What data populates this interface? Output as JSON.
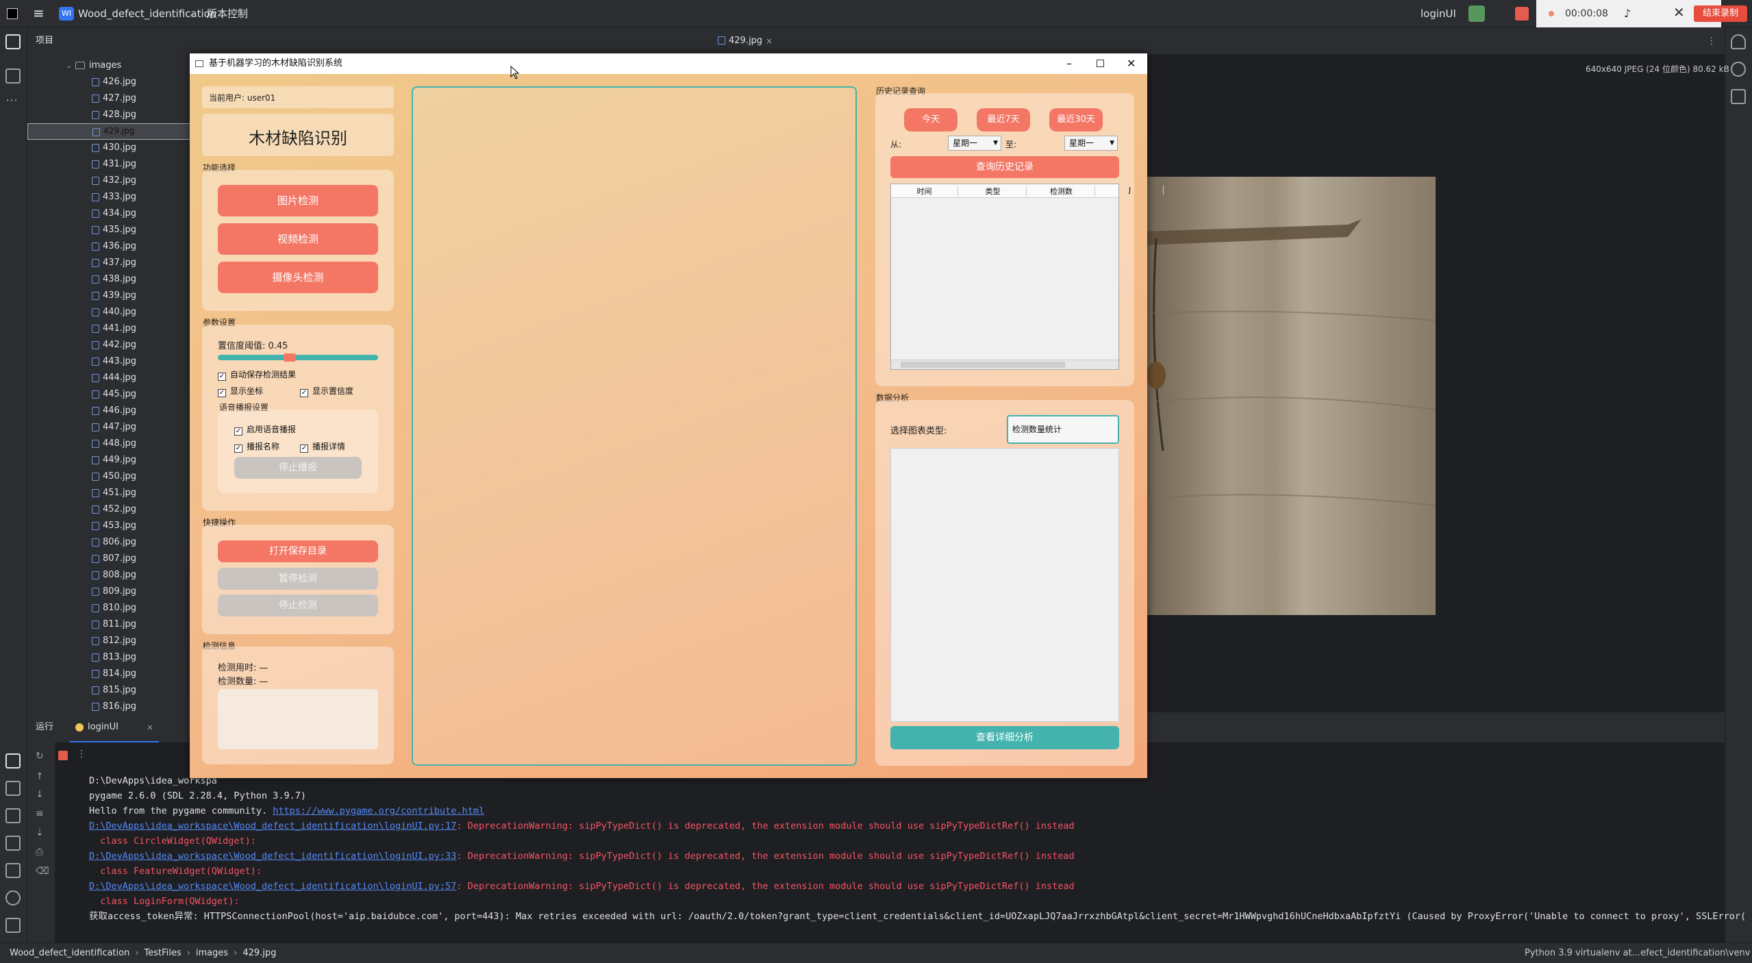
{
  "ide": {
    "project": "Wood_defect_identification",
    "project_badge": "WI",
    "vcs": "版本控制",
    "run_config": "loginUI",
    "project_label": "项目",
    "folder": "images",
    "editor_tab": "429.jpg",
    "image_info": "640x640 JPEG (24 位颜色) 80.62 kB",
    "run_label": "运行",
    "run_tab": "loginUI",
    "files": [
      "426.jpg",
      "427.jpg",
      "428.jpg",
      "429.jpg",
      "430.jpg",
      "431.jpg",
      "432.jpg",
      "433.jpg",
      "434.jpg",
      "435.jpg",
      "436.jpg",
      "437.jpg",
      "438.jpg",
      "439.jpg",
      "440.jpg",
      "441.jpg",
      "442.jpg",
      "443.jpg",
      "444.jpg",
      "445.jpg",
      "446.jpg",
      "447.jpg",
      "448.jpg",
      "449.jpg",
      "450.jpg",
      "451.jpg",
      "452.jpg",
      "453.jpg",
      "806.jpg",
      "807.jpg",
      "808.jpg",
      "809.jpg",
      "810.jpg",
      "811.jpg",
      "812.jpg",
      "813.jpg",
      "814.jpg",
      "815.jpg",
      "816.jpg"
    ],
    "selected_file": "429.jpg",
    "console": [
      "D:\\DevApps\\idea_workspa",
      "pygame 2.6.0 (SDL 2.28.4, Python 3.9.7)",
      "Hello from the pygame community. ",
      "https://www.pygame.org/contribute.html",
      "D:\\DevApps\\idea_workspace\\Wood_defect_identification\\loginUI.py:17",
      ": DeprecationWarning: sipPyTypeDict() is deprecated, the extension module should use sipPyTypeDictRef() instead",
      "  class CircleWidget(QWidget):",
      "D:\\DevApps\\idea_workspace\\Wood_defect_identification\\loginUI.py:33",
      ": DeprecationWarning: sipPyTypeDict() is deprecated, the extension module should use sipPyTypeDictRef() instead",
      "  class FeatureWidget(QWidget):",
      "D:\\DevApps\\idea_workspace\\Wood_defect_identification\\loginUI.py:57",
      ": DeprecationWarning: sipPyTypeDict() is deprecated, the extension module should use sipPyTypeDictRef() instead",
      "  class LoginForm(QWidget):",
      "获取access_token异常: HTTPSConnectionPool(host='aip.baidubce.com', port=443): Max retries exceeded with url: /oauth/2.0/token?grant_type=client_credentials&client_id=UOZxapLJQ7aaJrrxzhbGAtpl&client_secret=Mr1HWWpvghd16hUCneHdbxaAbIpfztYi (Caused by ProxyError('Unable to connect to proxy', SSLError(SSLEOF"
    ],
    "breadcrumb": [
      "Wood_defect_identification",
      "TestFiles",
      "images",
      "429.jpg"
    ],
    "interpreter": "Python 3.9 virtualenv at...efect_identification\\venv",
    "rec_time": "00:00:08",
    "rec_end": "结束录制"
  },
  "app": {
    "title": "基于机器学习的木材缺陷识别系统",
    "user": "当前用户: user01",
    "heading": "木材缺陷识别",
    "func_title": "功能选择",
    "btn_image": "图片检测",
    "btn_video": "视频检测",
    "btn_camera": "摄像头检测",
    "param_title": "参数设置",
    "conf_label": "置信度阈值: 0.45",
    "conf_value": 0.45,
    "cb_autosave": "自动保存检测结果",
    "cb_coords": "显示坐标",
    "cb_conf": "显示置信度",
    "voice_title": "语音播报设置",
    "cb_voice": "启用语音播报",
    "cb_name": "播报名称",
    "cb_detail": "播报详情",
    "btn_stop_voice": "停止播报",
    "quick_title": "快捷操作",
    "btn_open_dir": "打开保存目录",
    "btn_pause": "暂停检测",
    "btn_stop": "停止检测",
    "info_title": "检测信息",
    "time_label": "检测用时: —",
    "count_label": "检测数量: —",
    "history_title": "历史记录查询",
    "btn_today": "今天",
    "btn_7days": "最近7天",
    "btn_30days": "最近30天",
    "from_label": "从:",
    "to_label": "至:",
    "from_value": "星期一",
    "to_value": "星期一",
    "btn_query": "查询历史记录",
    "table_headers": [
      "时间",
      "类型",
      "检测数",
      "J"
    ],
    "analysis_title": "数据分析",
    "chart_type_label": "选择图表类型:",
    "chart_type_value": "检测数量统计",
    "btn_detail": "查看详细分析"
  }
}
